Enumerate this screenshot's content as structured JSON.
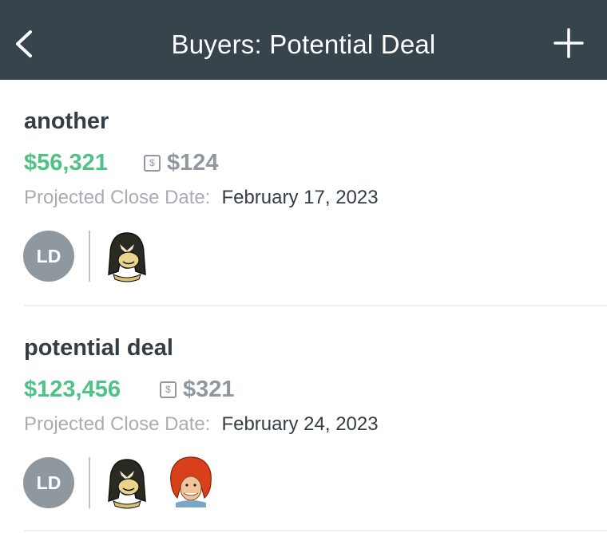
{
  "header": {
    "title": "Buyers: Potential Deal",
    "background": "#37444c"
  },
  "deals": [
    {
      "name": "another",
      "value": "$56,321",
      "commission": "$124",
      "close_label": "Projected Close Date:",
      "close_date": "February 17, 2023",
      "owner_initials": "LD",
      "participants": [
        "masked-hero-avatar"
      ]
    },
    {
      "name": "potential deal",
      "value": "$123,456",
      "commission": "$321",
      "close_label": "Projected Close Date:",
      "close_date": "February 24, 2023",
      "owner_initials": "LD",
      "participants": [
        "masked-hero-avatar",
        "red-haired-hero-avatar"
      ]
    }
  ],
  "icons": {
    "back": "chevron-left-icon",
    "add": "plus-icon",
    "commission": "dollar-badge-icon",
    "commission_glyph": "$"
  },
  "colors": {
    "value": "#4fc286",
    "commission": "#8f989e",
    "title": "#333d44",
    "label": "#a7adb2",
    "avatar": "#8e989e"
  }
}
